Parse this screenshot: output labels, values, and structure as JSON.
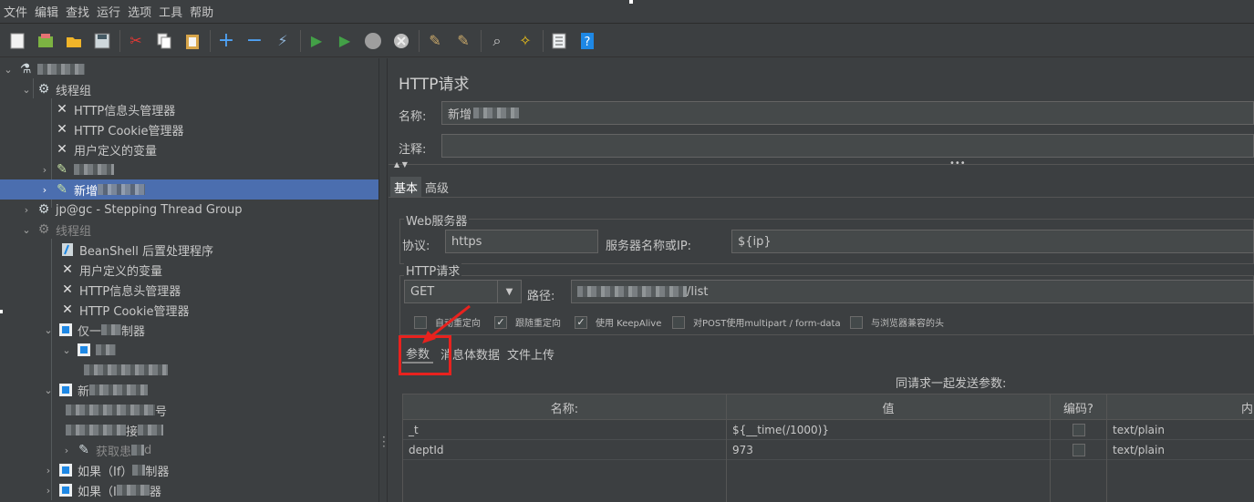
{
  "menu": [
    "文件",
    "编辑",
    "查找",
    "运行",
    "选项",
    "工具",
    "帮助"
  ],
  "toolbar_icons": [
    "new-icon",
    "templates-icon",
    "open-icon",
    "save-icon",
    "cut-icon",
    "copy-icon",
    "paste-icon",
    "expand-icon",
    "collapse-icon",
    "toggle-icon",
    "start-icon",
    "start-no-pause-icon",
    "stop-icon",
    "shutdown-icon",
    "clear-icon",
    "clear-all-icon",
    "search-icon",
    "reset-search-icon",
    "function-helper-icon",
    "help-icon"
  ],
  "tree": {
    "items": [
      {
        "label": "",
        "level": 0
      },
      {
        "label": "线程组",
        "level": 1
      },
      {
        "label": "HTTP信息头管理器",
        "level": 2
      },
      {
        "label": "HTTP Cookie管理器",
        "level": 2
      },
      {
        "label": "用户定义的变量",
        "level": 2
      },
      {
        "label": "",
        "level": 2
      },
      {
        "label": "新增",
        "level": 2
      },
      {
        "label": "jp@gc - Stepping Thread Group",
        "level": 1
      },
      {
        "label": "线程组",
        "level": 1
      },
      {
        "label": "BeanShell 后置处理程序",
        "level": 2
      },
      {
        "label": "用户定义的变量",
        "level": 2
      },
      {
        "label": "HTTP信息头管理器",
        "level": 2
      },
      {
        "label": "HTTP Cookie管理器",
        "level": 2
      },
      {
        "label": "仅一",
        "level": 2,
        "suffix": "制器"
      },
      {
        "label": "",
        "level": 3
      },
      {
        "label": "",
        "level": 4
      },
      {
        "label": "新",
        "level": 2
      },
      {
        "label": "",
        "level": 3,
        "suffix": "号"
      },
      {
        "label": "",
        "level": 3,
        "suffix": "接"
      },
      {
        "label": "获取患",
        "level": 3,
        "suffix": "d"
      },
      {
        "label": "如果（If）",
        "level": 2,
        "suffix": "制器"
      },
      {
        "label": "如果（I",
        "level": 2,
        "suffix": "器"
      }
    ]
  },
  "panel": {
    "title": "HTTP请求",
    "name_label": "名称:",
    "name_value": "新增",
    "comment_label": "注释:",
    "comment_value": "",
    "tabs": [
      "基本",
      "高级"
    ],
    "web_server_title": "Web服务器",
    "protocol_label": "协议:",
    "protocol_value": "https",
    "server_label": "服务器名称或IP:",
    "server_value": "${ip}",
    "http_request_title": "HTTP请求",
    "method_value": "GET",
    "path_label": "路径:",
    "path_value": "/list",
    "checkboxes": [
      {
        "label": "自动重定向",
        "checked": false
      },
      {
        "label": "跟随重定向",
        "checked": true
      },
      {
        "label": "使用 KeepAlive",
        "checked": true
      },
      {
        "label": "对POST使用multipart / form-data",
        "checked": false
      },
      {
        "label": "与浏览器兼容的头",
        "checked": false
      }
    ],
    "subtabs": [
      "参数",
      "消息体数据",
      "文件上传"
    ],
    "params_caption": "同请求一起发送参数:",
    "columns": [
      "名称:",
      "值",
      "编码?",
      "内"
    ],
    "rows": [
      {
        "name": "_t",
        "value": "${__time(/1000)}",
        "encode": false,
        "type": "text/plain"
      },
      {
        "name": "deptId",
        "value": "973",
        "encode": false,
        "type": "text/plain"
      }
    ]
  }
}
